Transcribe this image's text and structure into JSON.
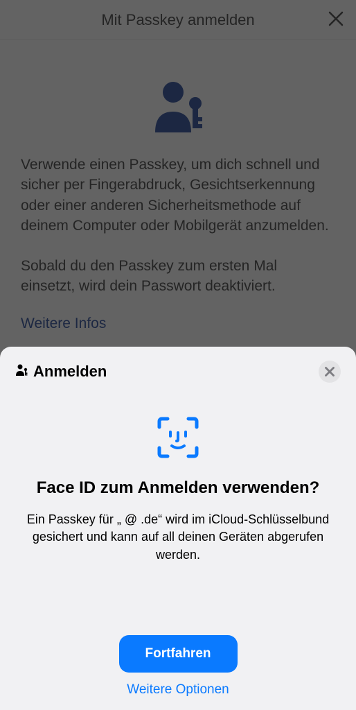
{
  "background": {
    "header": {
      "title": "Mit Passkey anmelden"
    },
    "paragraph1": "Verwende einen Passkey, um dich schnell und sicher per Fingerabdruck, Gesichtserkennung oder einer anderen Sicherheitsmethode auf deinem Computer oder Mobilgerät anzumelden.",
    "paragraph2": "Sobald du den Passkey zum ersten Mal einsetzt, wird dein Passwort deaktiviert.",
    "link": "Weitere Infos"
  },
  "sheet": {
    "title": "Anmelden",
    "heading": "Face ID zum Anmelden verwenden?",
    "body": "Ein Passkey für „                          @        .de“ wird im iCloud-Schlüsselbund gesichert und kann auf all deinen Geräten abgerufen werden.",
    "primary": "Fortfahren",
    "secondary": "Weitere Optionen"
  }
}
